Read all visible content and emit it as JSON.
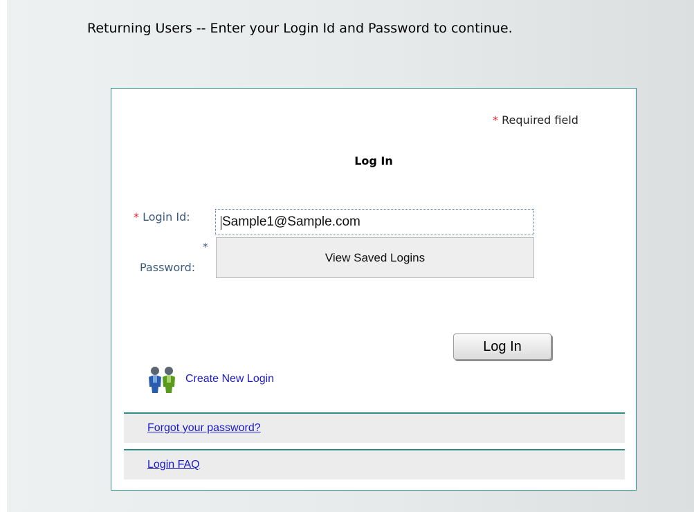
{
  "intro_text": "Returning Users -- Enter your Login Id and Password to continue.",
  "required_note": {
    "marker": "*",
    "text": "Required field"
  },
  "form": {
    "title": "Log In",
    "login_id": {
      "marker": "*",
      "label": "Login Id:",
      "value": "Sample1@Sample.com"
    },
    "password": {
      "marker": "*",
      "label": "Password:"
    },
    "saved_logins_label": "View Saved Logins",
    "submit_label": "Log In"
  },
  "create_login": {
    "icon": "users-icon",
    "label": "Create New Login"
  },
  "links": {
    "forgot_password": "Forgot your password?",
    "faq": "Login FAQ"
  },
  "colors": {
    "panel_border": "#2f8b86",
    "required_star": "#e0282d",
    "link": "#1a1acc",
    "label": "#3a5a7a"
  }
}
